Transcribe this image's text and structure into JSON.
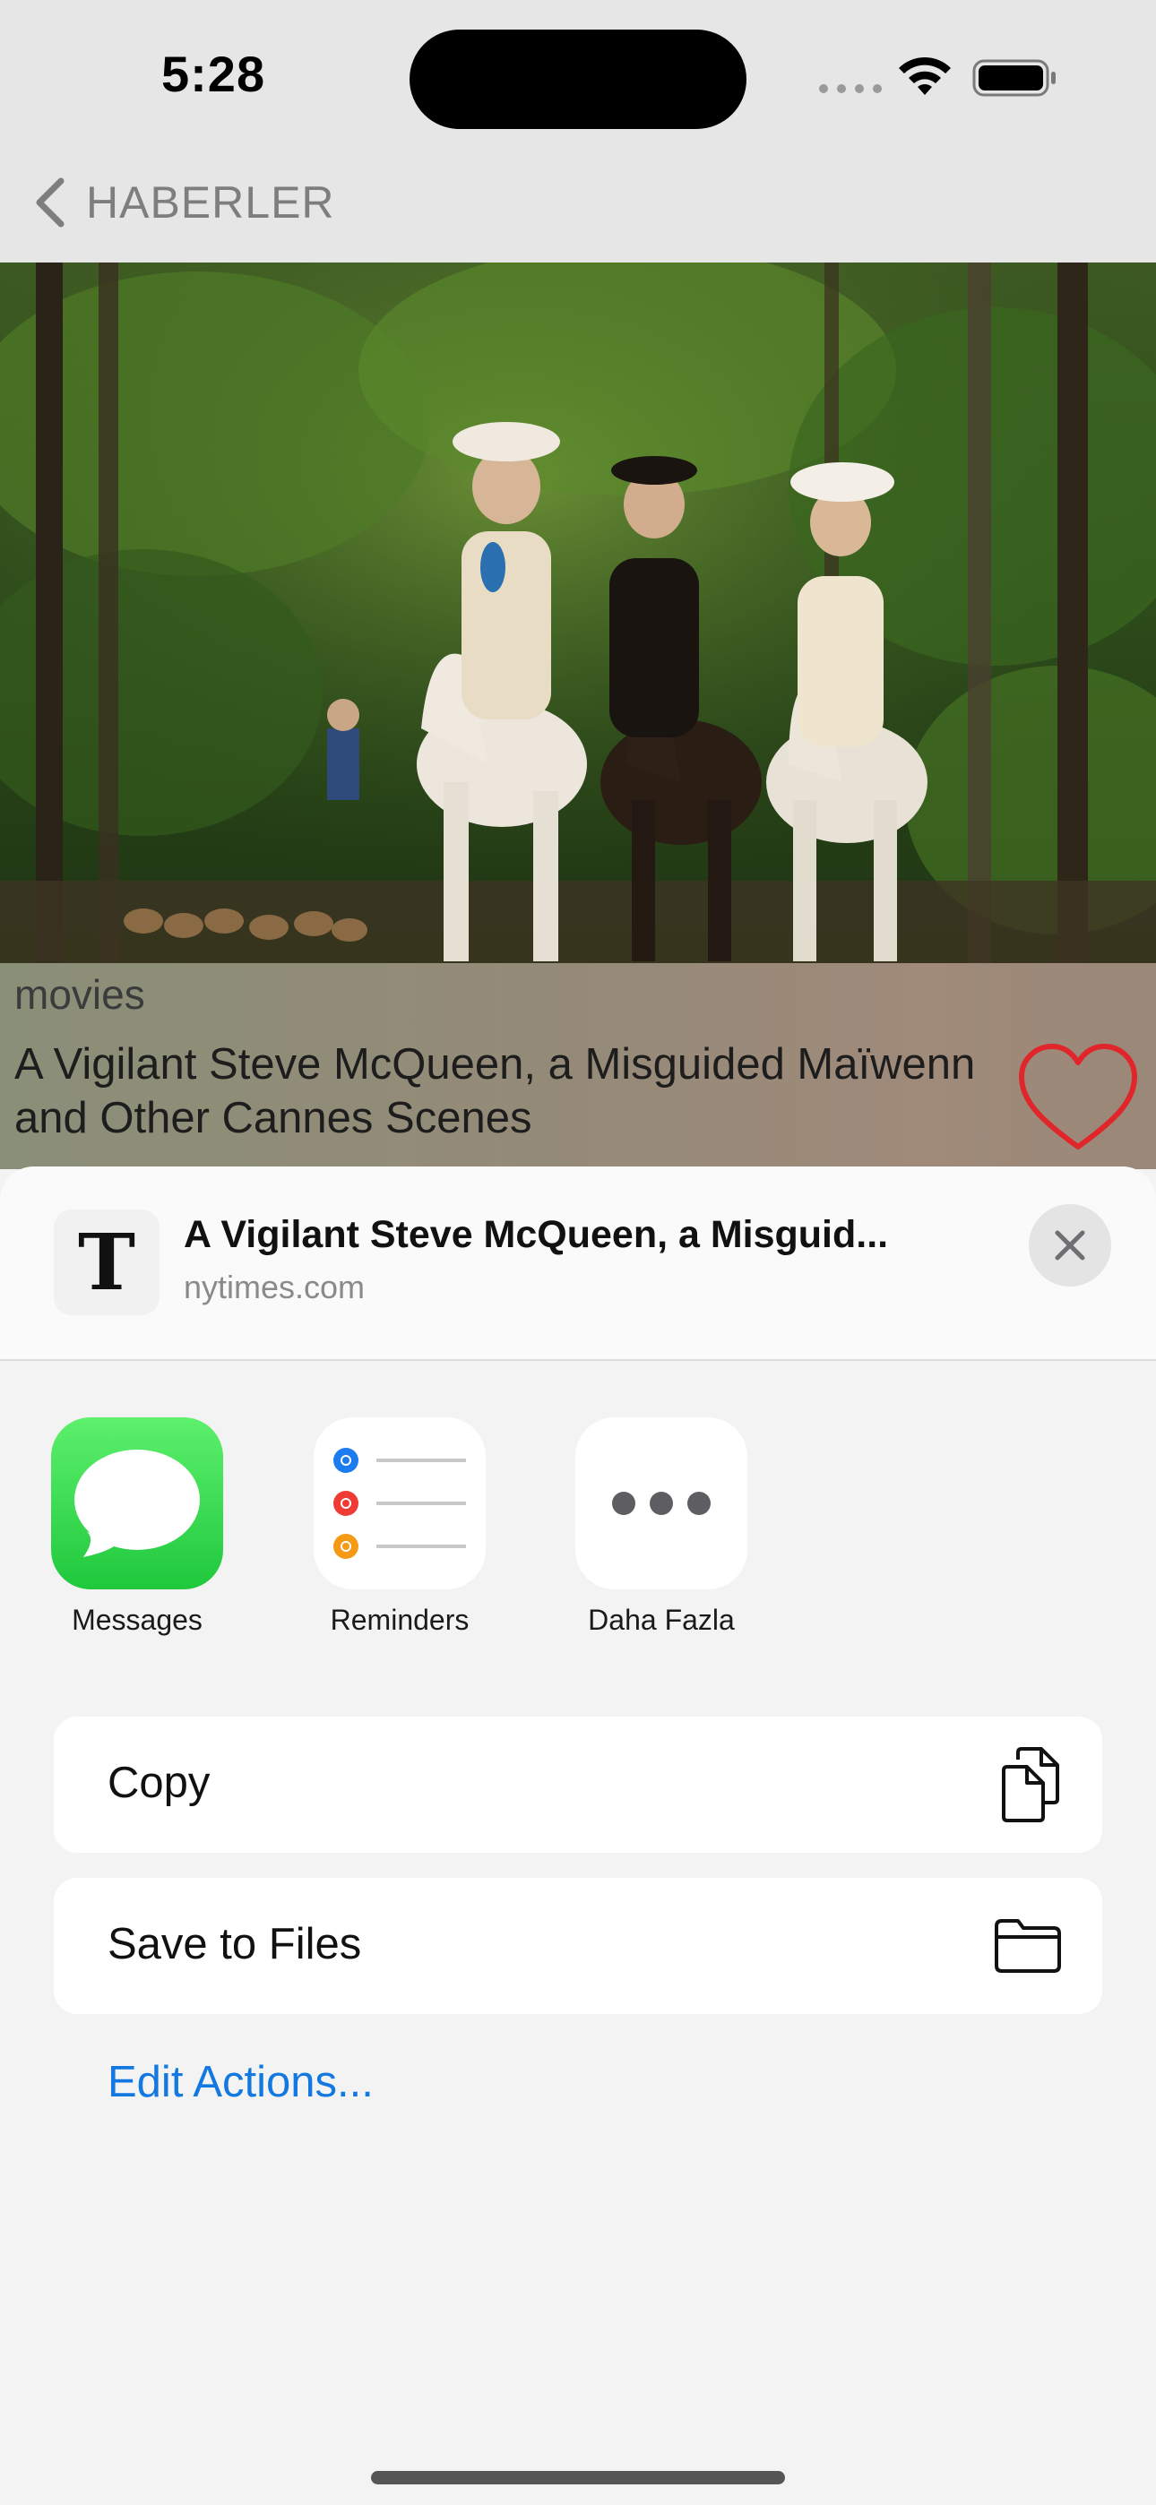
{
  "status_bar": {
    "time": "5:28"
  },
  "nav": {
    "back_label": "HABERLER"
  },
  "article": {
    "category": "movies",
    "headline": "A Vigilant Steve McQueen, a Misguided Maïwenn and Other Cannes Scenes"
  },
  "share_sheet": {
    "site_logo_letter": "T",
    "title": "A Vigilant Steve McQueen, a Misguid...",
    "domain": "nytimes.com",
    "apps": [
      {
        "label": "Messages",
        "icon": "messages-icon"
      },
      {
        "label": "Reminders",
        "icon": "reminders-icon"
      },
      {
        "label": "Daha Fazla",
        "icon": "more-icon"
      }
    ],
    "actions": [
      {
        "label": "Copy",
        "icon": "copy-icon"
      },
      {
        "label": "Save to Files",
        "icon": "folder-icon"
      }
    ],
    "edit_actions_label": "Edit Actions..."
  },
  "colors": {
    "accent": "#1378e0",
    "heart": "#e0262a",
    "messages_green": "#2bd14b"
  }
}
